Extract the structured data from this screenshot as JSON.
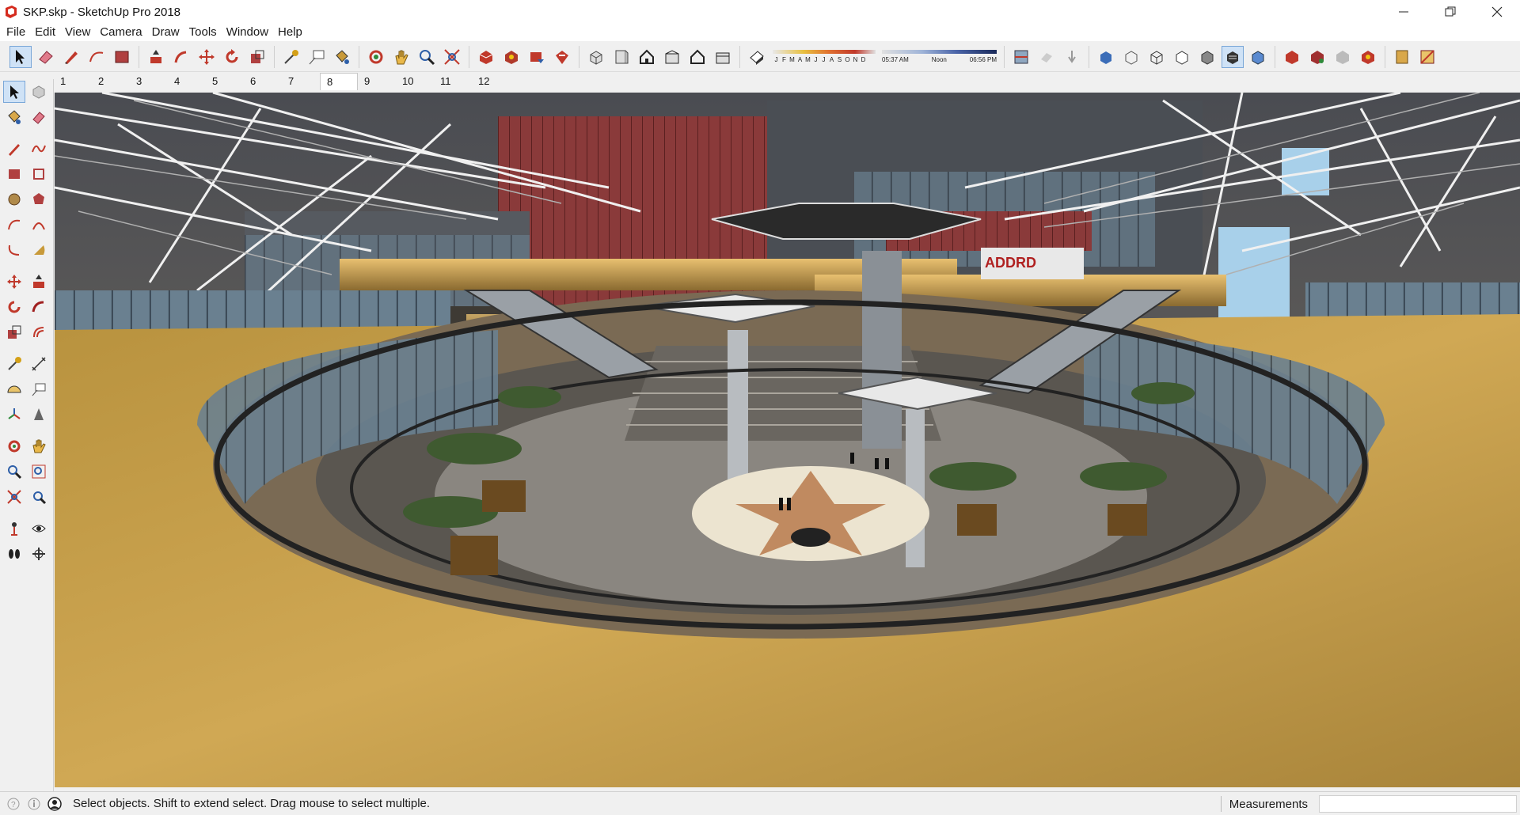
{
  "window": {
    "title": "SKP.skp - SketchUp Pro 2018"
  },
  "menu": [
    "File",
    "Edit",
    "View",
    "Camera",
    "Draw",
    "Tools",
    "Window",
    "Help"
  ],
  "shadows": {
    "months": [
      "J",
      "F",
      "M",
      "A",
      "M",
      "J",
      "J",
      "A",
      "S",
      "O",
      "N",
      "D"
    ],
    "time_start": "05:37 AM",
    "time_mid": "Noon",
    "time_end": "06:56 PM"
  },
  "scenes": {
    "tabs": [
      "1",
      "2",
      "3",
      "4",
      "5",
      "6",
      "7",
      "8",
      "9",
      "10",
      "11",
      "12"
    ],
    "active_index": 7
  },
  "viewport": {
    "sign_text": "ADDRD"
  },
  "status": {
    "message": "Select objects. Shift to extend select. Drag mouse to select multiple.",
    "measurements_label": "Measurements",
    "measurements_value": ""
  },
  "colors": {
    "accent_red": "#c0392b",
    "selection_blue": "#cfe2f6",
    "floor_gold": "#c8a050"
  }
}
